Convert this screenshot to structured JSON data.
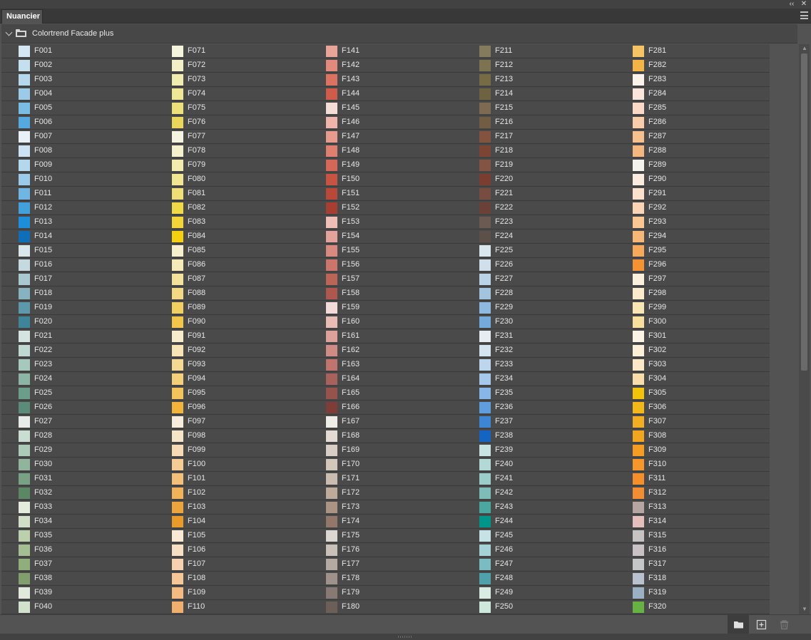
{
  "window": {
    "collapse_glyph": "‹‹",
    "close_glyph": "✕"
  },
  "tab": {
    "title": "Nuancier"
  },
  "group": {
    "name": "Colortrend Facade plus"
  },
  "toolbar": {
    "icons": [
      "new-group-folder-icon",
      "new-swatch-icon",
      "delete-icon"
    ]
  },
  "swatches": [
    [
      {
        "name": "F001",
        "color": "#d3e6f2"
      },
      {
        "name": "F002",
        "color": "#c4e0ef"
      },
      {
        "name": "F003",
        "color": "#b6d8ec"
      },
      {
        "name": "F004",
        "color": "#9ccbe8"
      },
      {
        "name": "F005",
        "color": "#7bbce6"
      },
      {
        "name": "F006",
        "color": "#55a9de"
      },
      {
        "name": "F007",
        "color": "#e8f1f5"
      },
      {
        "name": "F008",
        "color": "#cde3f3"
      },
      {
        "name": "F009",
        "color": "#b4d7ee"
      },
      {
        "name": "F010",
        "color": "#9acbea"
      },
      {
        "name": "F011",
        "color": "#6fb6e2"
      },
      {
        "name": "F012",
        "color": "#42a0db"
      },
      {
        "name": "F013",
        "color": "#1e8ed8"
      },
      {
        "name": "F014",
        "color": "#0f6eb8"
      },
      {
        "name": "F015",
        "color": "#d9e7ea"
      },
      {
        "name": "F016",
        "color": "#c4dadf"
      },
      {
        "name": "F017",
        "color": "#a9c9d0"
      },
      {
        "name": "F018",
        "color": "#86b3bf"
      },
      {
        "name": "F019",
        "color": "#5d99aa"
      },
      {
        "name": "F020",
        "color": "#3f8599"
      },
      {
        "name": "F021",
        "color": "#d5e4e0"
      },
      {
        "name": "F022",
        "color": "#bfd8d1"
      },
      {
        "name": "F023",
        "color": "#a7c8bd"
      },
      {
        "name": "F024",
        "color": "#8db5a6"
      },
      {
        "name": "F025",
        "color": "#6b9d8b"
      },
      {
        "name": "F026",
        "color": "#5a8c79"
      },
      {
        "name": "F027",
        "color": "#e6ede8"
      },
      {
        "name": "F028",
        "color": "#c9ddd0"
      },
      {
        "name": "F029",
        "color": "#adc9b7"
      },
      {
        "name": "F030",
        "color": "#91b59c"
      },
      {
        "name": "F031",
        "color": "#79a285"
      },
      {
        "name": "F032",
        "color": "#5b8765"
      },
      {
        "name": "F033",
        "color": "#e3ebdf"
      },
      {
        "name": "F034",
        "color": "#d1dfc9"
      },
      {
        "name": "F035",
        "color": "#bcd0ae"
      },
      {
        "name": "F036",
        "color": "#a4bd92"
      },
      {
        "name": "F037",
        "color": "#90ad7c"
      },
      {
        "name": "F038",
        "color": "#809f6c"
      },
      {
        "name": "F039",
        "color": "#e1e9dc"
      },
      {
        "name": "F040",
        "color": "#d2e1cb"
      }
    ],
    [
      {
        "name": "F071",
        "color": "#f4f3dc"
      },
      {
        "name": "F072",
        "color": "#f3f0c8"
      },
      {
        "name": "F073",
        "color": "#f1ecb0"
      },
      {
        "name": "F074",
        "color": "#efe696"
      },
      {
        "name": "F075",
        "color": "#ede07a"
      },
      {
        "name": "F076",
        "color": "#ead65b"
      },
      {
        "name": "F077",
        "color": "#f5f3e2"
      },
      {
        "name": "F078",
        "color": "#f4f1cc"
      },
      {
        "name": "F079",
        "color": "#f2ebad"
      },
      {
        "name": "F080",
        "color": "#f1e591"
      },
      {
        "name": "F081",
        "color": "#efdf76"
      },
      {
        "name": "F082",
        "color": "#f0d947"
      },
      {
        "name": "F083",
        "color": "#f3d53a"
      },
      {
        "name": "F084",
        "color": "#f4d010"
      },
      {
        "name": "F085",
        "color": "#f5efce"
      },
      {
        "name": "F086",
        "color": "#f5eab8"
      },
      {
        "name": "F087",
        "color": "#f4e19c"
      },
      {
        "name": "F088",
        "color": "#f3d983"
      },
      {
        "name": "F089",
        "color": "#f2cf61"
      },
      {
        "name": "F090",
        "color": "#f2c64b"
      },
      {
        "name": "F091",
        "color": "#f7ebcc"
      },
      {
        "name": "F092",
        "color": "#f7e3b5"
      },
      {
        "name": "F093",
        "color": "#f5d892"
      },
      {
        "name": "F094",
        "color": "#f4cf7a"
      },
      {
        "name": "F095",
        "color": "#f3c35c"
      },
      {
        "name": "F096",
        "color": "#f2b43b"
      },
      {
        "name": "F097",
        "color": "#f7eddc"
      },
      {
        "name": "F098",
        "color": "#f6e4c9"
      },
      {
        "name": "F099",
        "color": "#f5dab3"
      },
      {
        "name": "F100",
        "color": "#f5cd94"
      },
      {
        "name": "F101",
        "color": "#f4c079"
      },
      {
        "name": "F102",
        "color": "#f2b25a"
      },
      {
        "name": "F103",
        "color": "#eea43d"
      },
      {
        "name": "F104",
        "color": "#e89a2a"
      },
      {
        "name": "F105",
        "color": "#f8e8d4"
      },
      {
        "name": "F106",
        "color": "#f7dfc3"
      },
      {
        "name": "F107",
        "color": "#f6d3ae"
      },
      {
        "name": "F108",
        "color": "#f5c797"
      },
      {
        "name": "F109",
        "color": "#f3bb82"
      },
      {
        "name": "F110",
        "color": "#f1ae6c"
      }
    ],
    [
      {
        "name": "F141",
        "color": "#eaa399"
      },
      {
        "name": "F142",
        "color": "#e38a7c"
      },
      {
        "name": "F143",
        "color": "#db7262"
      },
      {
        "name": "F144",
        "color": "#cf5c4a"
      },
      {
        "name": "F145",
        "color": "#f4ddd6"
      },
      {
        "name": "F146",
        "color": "#f0b5aa"
      },
      {
        "name": "F147",
        "color": "#e79b8d"
      },
      {
        "name": "F148",
        "color": "#df7f70"
      },
      {
        "name": "F149",
        "color": "#d46757"
      },
      {
        "name": "F150",
        "color": "#c75443"
      },
      {
        "name": "F151",
        "color": "#b8493a"
      },
      {
        "name": "F152",
        "color": "#a63e31"
      },
      {
        "name": "F153",
        "color": "#eebfb7"
      },
      {
        "name": "F154",
        "color": "#e3a29a"
      },
      {
        "name": "F155",
        "color": "#d98a80"
      },
      {
        "name": "F156",
        "color": "#cc766b"
      },
      {
        "name": "F157",
        "color": "#bd6459"
      },
      {
        "name": "F158",
        "color": "#ad574d"
      },
      {
        "name": "F159",
        "color": "#f3dcd7"
      },
      {
        "name": "F160",
        "color": "#e9bcb6"
      },
      {
        "name": "F161",
        "color": "#dda19b"
      },
      {
        "name": "F162",
        "color": "#cf8b84"
      },
      {
        "name": "F163",
        "color": "#bf756e"
      },
      {
        "name": "F164",
        "color": "#a9625b"
      },
      {
        "name": "F165",
        "color": "#96524c"
      },
      {
        "name": "F166",
        "color": "#7e3d36"
      },
      {
        "name": "F167",
        "color": "#f0ece8"
      },
      {
        "name": "F168",
        "color": "#e2dad3"
      },
      {
        "name": "F169",
        "color": "#d9cec6"
      },
      {
        "name": "F170",
        "color": "#d3c7bc"
      },
      {
        "name": "F171",
        "color": "#cbbcb0"
      },
      {
        "name": "F172",
        "color": "#bfab9a"
      },
      {
        "name": "F173",
        "color": "#ab9483"
      },
      {
        "name": "F174",
        "color": "#93776a"
      },
      {
        "name": "F175",
        "color": "#dcd6d2"
      },
      {
        "name": "F176",
        "color": "#c9c0ba"
      },
      {
        "name": "F177",
        "color": "#b5aaa2"
      },
      {
        "name": "F178",
        "color": "#9f928a"
      },
      {
        "name": "F179",
        "color": "#877a72"
      },
      {
        "name": "F180",
        "color": "#6c5f58"
      }
    ],
    [
      {
        "name": "F211",
        "color": "#847a5e"
      },
      {
        "name": "F212",
        "color": "#7d7350"
      },
      {
        "name": "F213",
        "color": "#766b44"
      },
      {
        "name": "F214",
        "color": "#6f6240"
      },
      {
        "name": "F215",
        "color": "#7e6a52"
      },
      {
        "name": "F216",
        "color": "#735c44"
      },
      {
        "name": "F217",
        "color": "#84533f"
      },
      {
        "name": "F218",
        "color": "#7c4433"
      },
      {
        "name": "F219",
        "color": "#835344"
      },
      {
        "name": "F220",
        "color": "#7a3d2f"
      },
      {
        "name": "F221",
        "color": "#794c42"
      },
      {
        "name": "F222",
        "color": "#6b4037"
      },
      {
        "name": "F223",
        "color": "#6b5a4f"
      },
      {
        "name": "F224",
        "color": "#5d5048"
      },
      {
        "name": "F225",
        "color": "#dbe7ef"
      },
      {
        "name": "F226",
        "color": "#cfe0ec"
      },
      {
        "name": "F227",
        "color": "#bbd3e6"
      },
      {
        "name": "F228",
        "color": "#a3c4df"
      },
      {
        "name": "F229",
        "color": "#8fb9e0"
      },
      {
        "name": "F230",
        "color": "#75aadc"
      },
      {
        "name": "F231",
        "color": "#e6ecf1"
      },
      {
        "name": "F232",
        "color": "#d4e3f0"
      },
      {
        "name": "F233",
        "color": "#bdd6ee"
      },
      {
        "name": "F234",
        "color": "#a6c8ea"
      },
      {
        "name": "F235",
        "color": "#88b6e6"
      },
      {
        "name": "F236",
        "color": "#5f9ddf"
      },
      {
        "name": "F237",
        "color": "#3d86d6"
      },
      {
        "name": "F238",
        "color": "#1464c4"
      },
      {
        "name": "F239",
        "color": "#c9e3e2"
      },
      {
        "name": "F240",
        "color": "#b3d9d7"
      },
      {
        "name": "F241",
        "color": "#9ccdca"
      },
      {
        "name": "F242",
        "color": "#7dbcb8"
      },
      {
        "name": "F243",
        "color": "#4ba8a0"
      },
      {
        "name": "F244",
        "color": "#00958a"
      },
      {
        "name": "F245",
        "color": "#c6e2e6"
      },
      {
        "name": "F246",
        "color": "#a5d1d7"
      },
      {
        "name": "F247",
        "color": "#7bbcc3"
      },
      {
        "name": "F248",
        "color": "#4fa2ab"
      },
      {
        "name": "F249",
        "color": "#d9ebe3"
      },
      {
        "name": "F250",
        "color": "#cfe8dc"
      }
    ],
    [
      {
        "name": "F281",
        "color": "#f6c364"
      },
      {
        "name": "F282",
        "color": "#f4b446"
      },
      {
        "name": "F283",
        "color": "#fbf2ea"
      },
      {
        "name": "F284",
        "color": "#fbe5da"
      },
      {
        "name": "F285",
        "color": "#fadac6"
      },
      {
        "name": "F286",
        "color": "#f9cda9"
      },
      {
        "name": "F287",
        "color": "#f8c08f"
      },
      {
        "name": "F288",
        "color": "#f6b67f"
      },
      {
        "name": "F289",
        "color": "#f3f2ec"
      },
      {
        "name": "F290",
        "color": "#fbebdf"
      },
      {
        "name": "F291",
        "color": "#fbe0cd"
      },
      {
        "name": "F292",
        "color": "#fad4b5"
      },
      {
        "name": "F293",
        "color": "#f9c694"
      },
      {
        "name": "F294",
        "color": "#f7b776"
      },
      {
        "name": "F295",
        "color": "#f5a95a"
      },
      {
        "name": "F296",
        "color": "#f49234"
      },
      {
        "name": "F297",
        "color": "#fbf0dd"
      },
      {
        "name": "F298",
        "color": "#fbebcc"
      },
      {
        "name": "F299",
        "color": "#f9e6b5"
      },
      {
        "name": "F300",
        "color": "#f7df9e"
      },
      {
        "name": "F301",
        "color": "#fbf3e4"
      },
      {
        "name": "F302",
        "color": "#fbefd8"
      },
      {
        "name": "F303",
        "color": "#fae8c6"
      },
      {
        "name": "F304",
        "color": "#f8ddaa"
      },
      {
        "name": "F305",
        "color": "#f3c30c"
      },
      {
        "name": "F306",
        "color": "#f2b81a"
      },
      {
        "name": "F307",
        "color": "#f2ad22"
      },
      {
        "name": "F308",
        "color": "#f2a51e"
      },
      {
        "name": "F309",
        "color": "#f49d22"
      },
      {
        "name": "F310",
        "color": "#f5972a"
      },
      {
        "name": "F311",
        "color": "#f58f2c"
      },
      {
        "name": "F312",
        "color": "#f38d34"
      },
      {
        "name": "F313",
        "color": "#b6a5a3"
      },
      {
        "name": "F314",
        "color": "#e6bebb"
      },
      {
        "name": "F315",
        "color": "#c8c3c3"
      },
      {
        "name": "F316",
        "color": "#c9c1c5"
      },
      {
        "name": "F317",
        "color": "#c5c6c8"
      },
      {
        "name": "F318",
        "color": "#b9c1ce"
      },
      {
        "name": "F319",
        "color": "#9cb0c3"
      },
      {
        "name": "F320",
        "color": "#66b344"
      }
    ]
  ]
}
